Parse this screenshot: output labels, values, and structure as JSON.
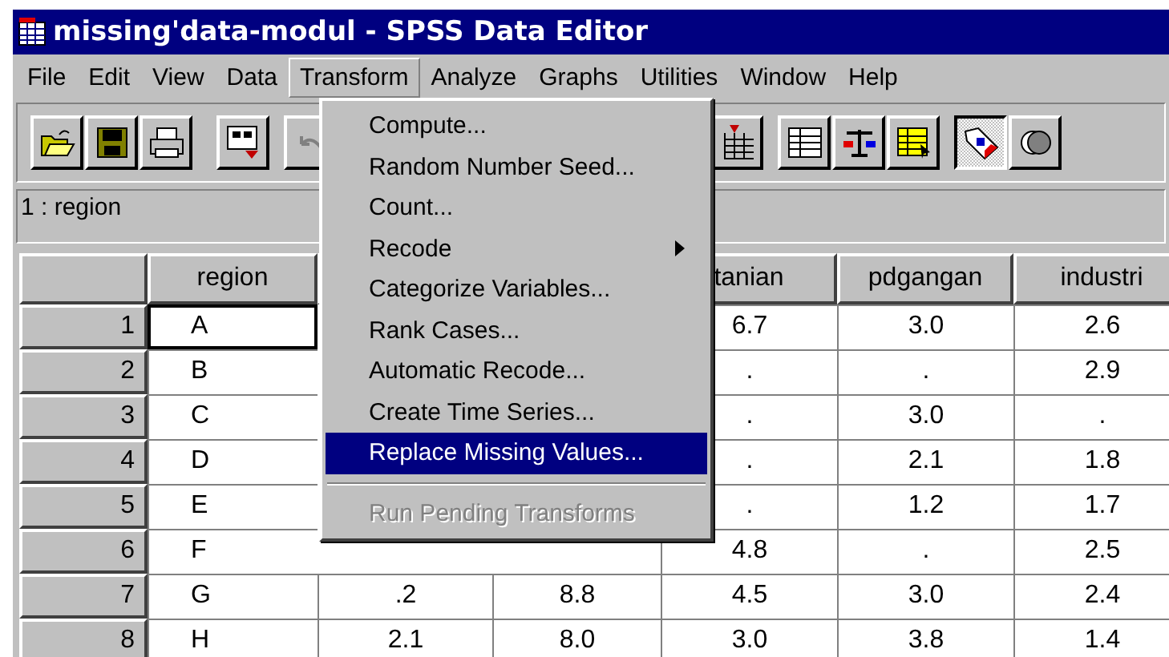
{
  "window": {
    "title": "missing'data-modul - SPSS Data Editor"
  },
  "menu_bar": [
    {
      "label": "File",
      "selected": false
    },
    {
      "label": "Edit",
      "selected": false
    },
    {
      "label": "View",
      "selected": false
    },
    {
      "label": "Data",
      "selected": false
    },
    {
      "label": "Transform",
      "selected": true
    },
    {
      "label": "Analyze",
      "selected": false
    },
    {
      "label": "Graphs",
      "selected": false
    },
    {
      "label": "Utilities",
      "selected": false
    },
    {
      "label": "Window",
      "selected": false
    },
    {
      "label": "Help",
      "selected": false
    }
  ],
  "toolbar": [
    {
      "kind": "open",
      "pressed": false
    },
    {
      "kind": "save",
      "pressed": false
    },
    {
      "kind": "print",
      "pressed": false
    },
    {
      "kind": "recall",
      "pressed": false
    },
    {
      "kind": "undo",
      "pressed": false
    },
    {
      "kind": "insert-case",
      "pressed": false
    },
    {
      "kind": "variables",
      "pressed": false
    },
    {
      "kind": "weight",
      "pressed": false
    },
    {
      "kind": "select-cases",
      "pressed": false
    },
    {
      "kind": "value-labels",
      "pressed": true
    },
    {
      "kind": "sets",
      "pressed": false
    }
  ],
  "cell_editor": {
    "reference": "1 : region"
  },
  "table": {
    "columns": [
      "region",
      "",
      "",
      "tanian",
      "pdgangan",
      "industri"
    ],
    "rows": [
      {
        "number": "1",
        "selected": true,
        "cells": [
          "A",
          null,
          null,
          "6.7",
          "3.0",
          "2.6"
        ]
      },
      {
        "number": "2",
        "selected": false,
        "cells": [
          "B",
          null,
          null,
          ".",
          ".",
          "2.9"
        ]
      },
      {
        "number": "3",
        "selected": false,
        "cells": [
          "C",
          null,
          null,
          ".",
          "3.0",
          "."
        ]
      },
      {
        "number": "4",
        "selected": false,
        "cells": [
          "D",
          null,
          null,
          ".",
          "2.1",
          "1.8"
        ]
      },
      {
        "number": "5",
        "selected": false,
        "cells": [
          "E",
          null,
          null,
          ".",
          "1.2",
          "1.7"
        ]
      },
      {
        "number": "6",
        "selected": false,
        "cells": [
          "F",
          null,
          null,
          "4.8",
          ".",
          "2.5"
        ]
      },
      {
        "number": "7",
        "selected": false,
        "cells": [
          "G",
          ".2",
          "8.8",
          "4.5",
          "3.0",
          "2.4"
        ]
      },
      {
        "number": "8",
        "selected": false,
        "cells": [
          "H",
          "2.1",
          "8.0",
          "3.0",
          "3.8",
          "1.4"
        ]
      }
    ]
  },
  "transform_menu": [
    {
      "kind": "item",
      "label": "Compute...",
      "submenu": false,
      "selected": false,
      "disabled": false
    },
    {
      "kind": "item",
      "label": "Random Number Seed...",
      "submenu": false,
      "selected": false,
      "disabled": false
    },
    {
      "kind": "item",
      "label": "Count...",
      "submenu": false,
      "selected": false,
      "disabled": false
    },
    {
      "kind": "item",
      "label": "Recode",
      "submenu": true,
      "selected": false,
      "disabled": false
    },
    {
      "kind": "item",
      "label": "Categorize Variables...",
      "submenu": false,
      "selected": false,
      "disabled": false
    },
    {
      "kind": "item",
      "label": "Rank Cases...",
      "submenu": false,
      "selected": false,
      "disabled": false
    },
    {
      "kind": "item",
      "label": "Automatic Recode...",
      "submenu": false,
      "selected": false,
      "disabled": false
    },
    {
      "kind": "item",
      "label": "Create Time Series...",
      "submenu": false,
      "selected": false,
      "disabled": false
    },
    {
      "kind": "item",
      "label": "Replace Missing Values...",
      "submenu": false,
      "selected": true,
      "disabled": false
    },
    {
      "kind": "separator"
    },
    {
      "kind": "item",
      "label": "Run Pending Transforms",
      "submenu": false,
      "selected": false,
      "disabled": true
    }
  ]
}
